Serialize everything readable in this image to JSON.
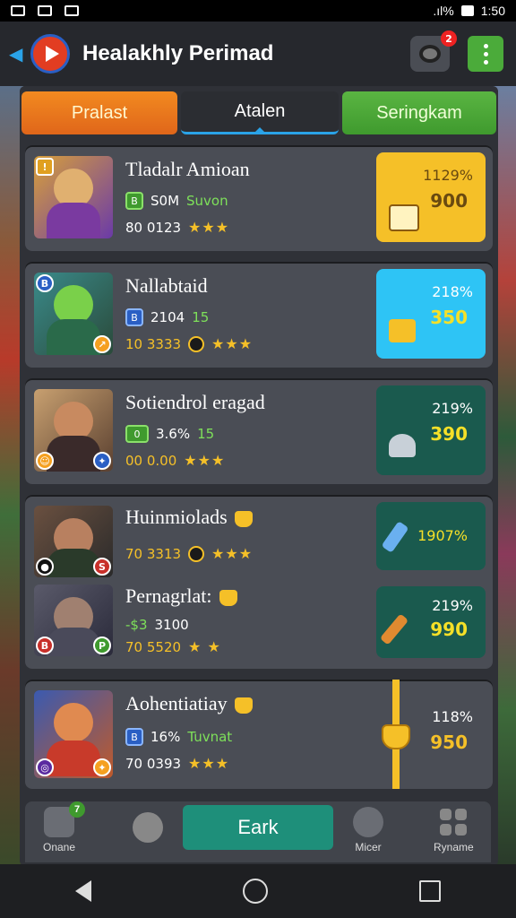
{
  "status_bar": {
    "time": "1:50",
    "signal": ".ıl%"
  },
  "app_bar": {
    "title": "Healakhly Perimad",
    "notification_count": "2"
  },
  "tabs": [
    {
      "label": "Pralast",
      "color": "#f28a20"
    },
    {
      "label": "Atalen",
      "active": true
    },
    {
      "label": "Seringkam",
      "color": "#5ab542"
    }
  ],
  "cards": [
    {
      "name": "Tladalr Amioan",
      "chip": "B",
      "stat1": "S0M",
      "stat2": "Suvon",
      "line2": "80 0123",
      "stars": "★★★",
      "reward_pct": "1129%",
      "reward_value": "900",
      "reward_color": "#f5c028"
    },
    {
      "name": "Nallabtaid",
      "chip": "B",
      "stat1": "2104",
      "stat2": "15",
      "line2": "10 3333",
      "stars": "★★★",
      "reward_pct": "218%",
      "reward_value": "350",
      "reward_color": "#2ec4f5"
    },
    {
      "name": "Sotiendrol eragad",
      "chip": "0",
      "stat1": "3.6%",
      "stat2": "15",
      "line2": "00 0.00",
      "stars": "★★★",
      "reward_pct": "219%",
      "reward_value": "390",
      "reward_color": "#1a5a4e"
    },
    {
      "name": "Huinmiolads",
      "line2": "70 3313",
      "stars": "★★★",
      "reward_value": "1907%",
      "reward_color": "#1a5a4e"
    },
    {
      "name": "Pernagrlat:",
      "stat1": "-$3",
      "stat2": "3100",
      "line2": "70 5520",
      "stars": "★ ★",
      "reward_pct": "219%",
      "reward_value": "990",
      "reward_color": "#1a5a4e"
    },
    {
      "name": "Aohentiatiay",
      "chip": "B",
      "stat1": "16%",
      "stat2": "Tuvnat",
      "line2": "70 0393",
      "stars": "★★★",
      "reward_pct": "118%",
      "reward_value": "950"
    }
  ],
  "toolbar": {
    "left_label": "Onane",
    "left_badge": "7",
    "earn_label": "Eark",
    "right1_label": "Micer",
    "right2_label": "Ryname"
  }
}
